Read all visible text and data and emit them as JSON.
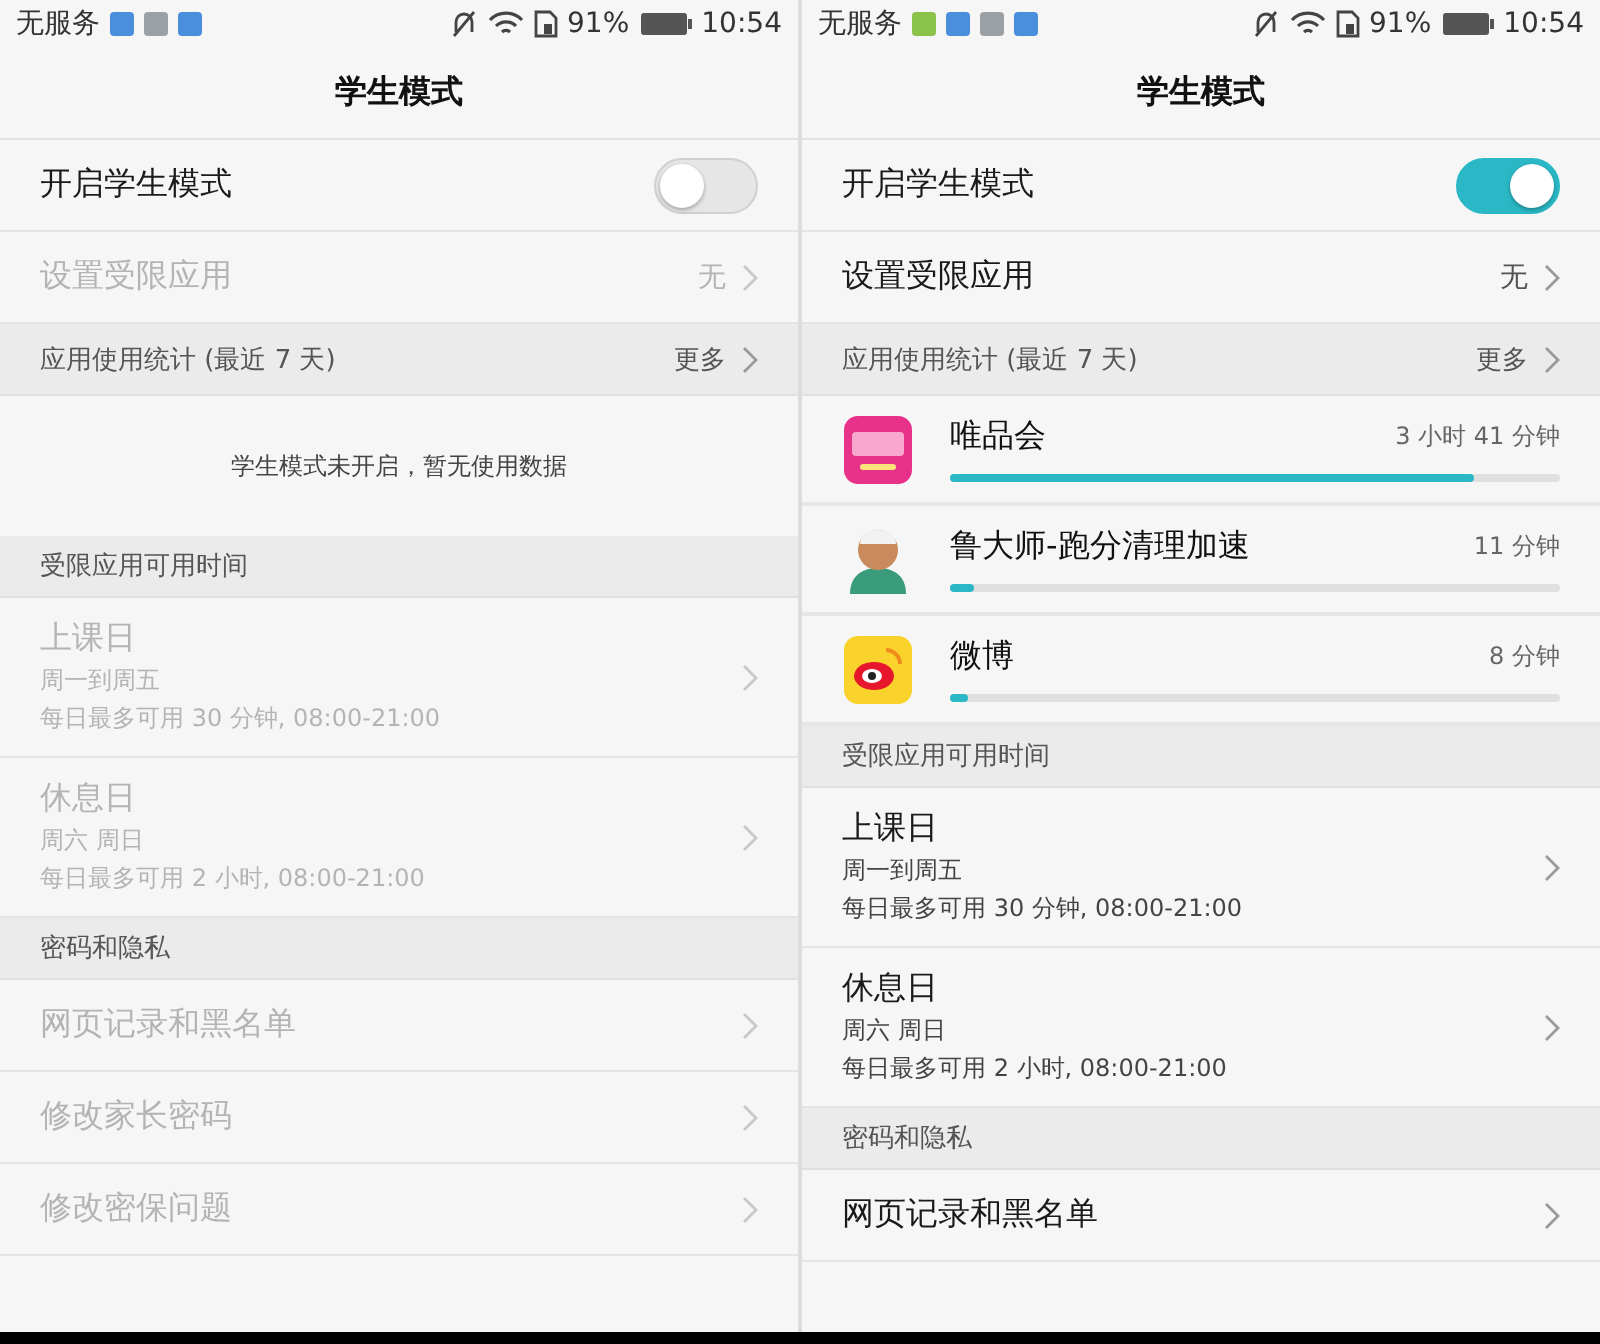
{
  "screens": [
    {
      "status_bar": {
        "carrier": "无服务",
        "notification_icons": [
          {
            "color": "#4a8fdc"
          },
          {
            "color": "#9aa0a6"
          },
          {
            "color": "#4a8fdc"
          }
        ],
        "battery": "91%",
        "time": "10:54"
      },
      "title": "学生模式",
      "switch_row": {
        "label": "开启学生模式",
        "on": false
      },
      "restricted_row": {
        "label": "设置受限应用",
        "value": "无",
        "disabled": true
      },
      "usage": {
        "header": "应用使用统计 (最近 7 天)",
        "more": "更多",
        "empty_message": "学生模式未开启，暂无使用数据"
      },
      "sections": [
        {
          "header": "受限应用可用时间",
          "items": [
            {
              "title": "上课日",
              "lines": [
                "周一到周五",
                "每日最多可用 30 分钟, 08:00-21:00"
              ],
              "disabled": true
            },
            {
              "title": "休息日",
              "lines": [
                "周六 周日",
                "每日最多可用 2 小时, 08:00-21:00"
              ],
              "disabled": true
            }
          ]
        },
        {
          "header": "密码和隐私",
          "items": [
            {
              "title": "网页记录和黑名单",
              "disabled": true
            },
            {
              "title": "修改家长密码",
              "disabled": true
            },
            {
              "title": "修改密保问题",
              "disabled": true
            }
          ]
        }
      ]
    },
    {
      "status_bar": {
        "carrier": "无服务",
        "notification_icons": [
          {
            "color": "#8bc34a"
          },
          {
            "color": "#4a8fdc"
          },
          {
            "color": "#9aa0a6"
          },
          {
            "color": "#4a8fdc"
          }
        ],
        "battery": "91%",
        "time": "10:54"
      },
      "title": "学生模式",
      "switch_row": {
        "label": "开启学生模式",
        "on": true
      },
      "restricted_row": {
        "label": "设置受限应用",
        "value": "无",
        "disabled": false
      },
      "usage": {
        "header": "应用使用统计 (最近 7 天)",
        "more": "更多",
        "apps": [
          {
            "kind": "shop",
            "name": "唯品会",
            "duration": "3 小时 41 分钟",
            "level": 0.86
          },
          {
            "kind": "mascot",
            "name": "鲁大师-跑分清理加速",
            "duration": "11 分钟",
            "level": 0.04
          },
          {
            "kind": "weibo",
            "name": "微博",
            "duration": "8 分钟",
            "level": 0.03
          }
        ]
      },
      "sections": [
        {
          "header": "受限应用可用时间",
          "items": [
            {
              "title": "上课日",
              "lines": [
                "周一到周五",
                "每日最多可用 30 分钟, 08:00-21:00"
              ],
              "disabled": false
            },
            {
              "title": "休息日",
              "lines": [
                "周六 周日",
                "每日最多可用 2 小时, 08:00-21:00"
              ],
              "disabled": false
            }
          ]
        },
        {
          "header": "密码和隐私",
          "items": [
            {
              "title": "网页记录和黑名单",
              "disabled": false
            }
          ]
        }
      ]
    }
  ]
}
